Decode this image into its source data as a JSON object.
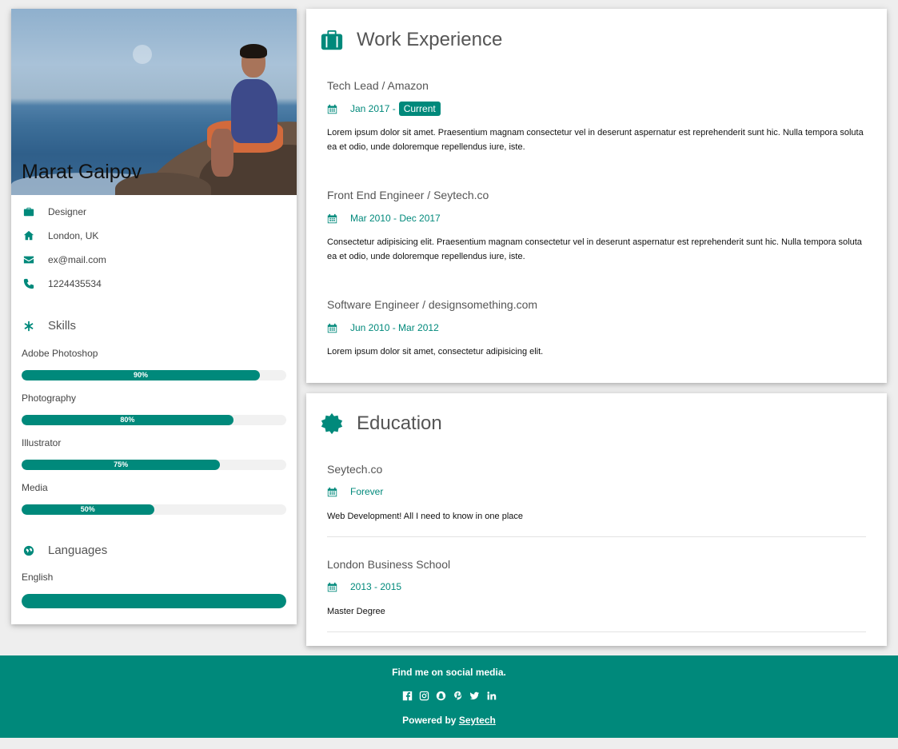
{
  "profile": {
    "name": "Marat Gaipov",
    "role": "Designer",
    "location": "London, UK",
    "email": "ex@mail.com",
    "phone": "1224435534"
  },
  "skills": {
    "heading": "Skills",
    "items": [
      {
        "name": "Adobe Photoshop",
        "percent": 90,
        "label": "90%"
      },
      {
        "name": "Photography",
        "percent": 80,
        "label": "80%"
      },
      {
        "name": "Illustrator",
        "percent": 75,
        "label": "75%"
      },
      {
        "name": "Media",
        "percent": 50,
        "label": "50%"
      }
    ]
  },
  "languages": {
    "heading": "Languages",
    "items": [
      {
        "name": "English",
        "percent": 100
      }
    ]
  },
  "work": {
    "heading": "Work Experience",
    "entries": [
      {
        "title": "Tech Lead / Amazon",
        "date": "Jan 2017 -",
        "tag": "Current",
        "desc": "Lorem ipsum dolor sit amet. Praesentium magnam consectetur vel in deserunt aspernatur est reprehenderit sunt hic. Nulla tempora soluta ea et odio, unde doloremque repellendus iure, iste."
      },
      {
        "title": "Front End Engineer / Seytech.co",
        "date": "Mar 2010 - Dec 2017",
        "desc": "Consectetur adipisicing elit. Praesentium magnam consectetur vel in deserunt aspernatur est reprehenderit sunt hic. Nulla tempora soluta ea et odio, unde doloremque repellendus iure, iste."
      },
      {
        "title": "Software Engineer / designsomething.com",
        "date": "Jun 2010 - Mar 2012",
        "desc": "Lorem ipsum dolor sit amet, consectetur adipisicing elit."
      }
    ]
  },
  "education": {
    "heading": "Education",
    "entries": [
      {
        "title": "Seytech.co",
        "date": "Forever",
        "desc": "Web Development! All I need to know in one place"
      },
      {
        "title": "London Business School",
        "date": "2013 - 2015",
        "desc": "Master Degree"
      }
    ]
  },
  "footer": {
    "find": "Find me on social media.",
    "powered_prefix": "Powered by",
    "powered_link": "Seytech",
    "socials": [
      "facebook-icon",
      "instagram-icon",
      "snapchat-icon",
      "pinterest-icon",
      "twitter-icon",
      "linkedin-icon"
    ]
  },
  "colors": {
    "accent": "#00897b",
    "background": "#eeeeee"
  }
}
